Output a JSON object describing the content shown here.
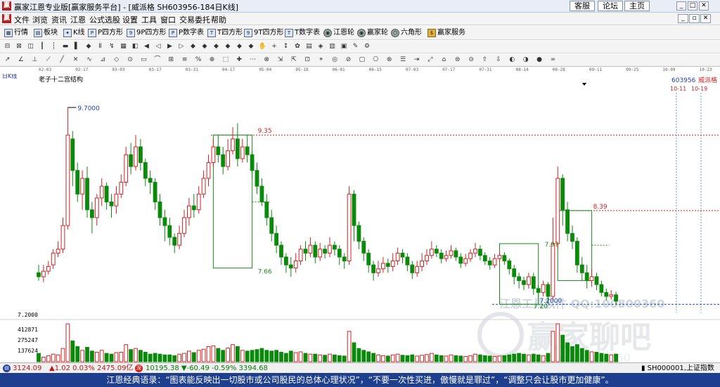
{
  "window": {
    "title": "赢家江恩专业版[赢家服务平台] - [威派格  SH603956-184日K线]",
    "links": [
      "客服",
      "论坛",
      "主页"
    ]
  },
  "menu": [
    "文件",
    "浏览",
    "资讯",
    "江恩",
    "公式选股",
    "设置",
    "工具",
    "窗口",
    "交易委托",
    "帮助"
  ],
  "toolbar": [
    "行情",
    "板块",
    "K线",
    "P四方形",
    "9P四方形",
    "P数字表",
    "T四方形",
    "9T四方形",
    "T数字表",
    "江恩轮",
    "赢家轮",
    "六角形",
    "赢家服务"
  ],
  "date_axis": [
    "02-03",
    "02-17",
    "03-03",
    "03-17",
    "03-31",
    "04-17",
    "05-04",
    "05-18",
    "06-01",
    "06-15",
    "07-03",
    "07-17",
    "07-31",
    "08-14",
    "08-28",
    "09-11",
    "09-25",
    "10-09",
    "10-23"
  ],
  "chart_panel": {
    "period_label": "日K线",
    "structure_label": "老子十二宫结构",
    "stock_code": "603956",
    "stock_name": "威派格",
    "future_dates": [
      "10-11",
      "10-19"
    ],
    "price_labels": {
      "peak": "9.7000",
      "box1_top": "9.35",
      "box1_bottom": "7.66",
      "box2_top": "8.39",
      "ref_line": "7.2000",
      "box3_top": "7.97",
      "box3_bottom": "7.20"
    },
    "ref_axis_label": "7.2000",
    "vol_axis": [
      "412871",
      "275247",
      "137624"
    ],
    "watermark": "江恩工具软件  QQ:100800360",
    "forum_watermark": "赢家聊吧",
    "forum_sub": "liaoba.yingjia360"
  },
  "colors": {
    "up": "#d62020",
    "down": "#0a8a0a",
    "box": "#1a8a1a",
    "resistance": "#d62020",
    "peak_label": "#2040b0"
  },
  "chart_data": {
    "type": "candlestick",
    "title": "威派格 SH603956 日K线",
    "price_range": [
      7.05,
      9.95
    ],
    "reference_prices": [
      9.35,
      8.39,
      7.66,
      7.2
    ],
    "series": [
      {
        "name": "price",
        "values": [
          [
            7.6,
            7.55,
            7.7,
            7.5
          ],
          [
            7.55,
            7.62,
            7.7,
            7.48
          ],
          [
            7.62,
            7.68,
            7.75,
            7.58
          ],
          [
            7.7,
            7.85,
            7.9,
            7.65
          ],
          [
            7.85,
            7.9,
            8.0,
            7.8
          ],
          [
            7.9,
            8.2,
            8.3,
            7.85
          ],
          [
            8.2,
            9.35,
            9.7,
            8.15
          ],
          [
            9.3,
            8.9,
            9.4,
            8.7
          ],
          [
            8.9,
            8.6,
            9.0,
            8.5
          ],
          [
            8.6,
            8.8,
            8.9,
            8.4
          ],
          [
            8.8,
            8.4,
            8.95,
            8.3
          ],
          [
            8.4,
            8.3,
            8.5,
            8.1
          ],
          [
            8.3,
            8.55,
            8.6,
            8.2
          ],
          [
            8.55,
            8.7,
            8.8,
            8.45
          ],
          [
            8.7,
            8.5,
            8.75,
            8.4
          ],
          [
            8.5,
            8.45,
            8.6,
            8.3
          ],
          [
            8.45,
            8.6,
            8.7,
            8.35
          ],
          [
            8.6,
            8.75,
            8.85,
            8.55
          ],
          [
            8.75,
            9.1,
            9.2,
            8.7
          ],
          [
            9.1,
            8.95,
            9.25,
            8.85
          ],
          [
            8.95,
            9.2,
            9.35,
            8.9
          ],
          [
            9.2,
            9.0,
            9.3,
            8.9
          ],
          [
            9.0,
            8.8,
            9.05,
            8.7
          ],
          [
            8.8,
            8.75,
            8.9,
            8.6
          ],
          [
            8.75,
            8.5,
            8.8,
            8.4
          ],
          [
            8.5,
            8.3,
            8.6,
            8.2
          ],
          [
            8.3,
            8.2,
            8.4,
            8.0
          ],
          [
            8.2,
            8.05,
            8.3,
            7.95
          ],
          [
            8.05,
            7.95,
            8.1,
            7.85
          ],
          [
            7.95,
            8.1,
            8.2,
            7.9
          ],
          [
            8.1,
            8.3,
            8.4,
            8.05
          ],
          [
            8.3,
            8.45,
            8.55,
            8.2
          ],
          [
            8.45,
            8.4,
            8.6,
            8.3
          ],
          [
            8.4,
            8.6,
            8.7,
            8.35
          ],
          [
            8.6,
            8.8,
            8.9,
            8.55
          ],
          [
            8.8,
            9.0,
            9.1,
            8.7
          ],
          [
            9.0,
            9.2,
            9.3,
            8.95
          ],
          [
            9.2,
            9.1,
            9.35,
            9.0
          ],
          [
            9.1,
            8.95,
            9.2,
            8.85
          ],
          [
            8.95,
            9.15,
            9.3,
            8.9
          ],
          [
            9.15,
            9.3,
            9.45,
            9.1
          ],
          [
            9.3,
            9.05,
            9.5,
            8.95
          ],
          [
            9.05,
            9.2,
            9.3,
            9.0
          ],
          [
            9.2,
            9.1,
            9.35,
            9.0
          ],
          [
            9.1,
            8.9,
            9.15,
            8.8
          ],
          [
            8.9,
            8.7,
            9.0,
            8.6
          ],
          [
            8.7,
            8.5,
            8.8,
            8.45
          ],
          [
            8.5,
            8.3,
            8.6,
            8.2
          ],
          [
            8.3,
            8.1,
            8.4,
            8.0
          ],
          [
            8.1,
            7.95,
            8.2,
            7.85
          ],
          [
            7.95,
            7.8,
            8.0,
            7.7
          ],
          [
            7.8,
            7.7,
            7.85,
            7.6
          ],
          [
            7.7,
            7.66,
            7.8,
            7.55
          ],
          [
            7.66,
            7.75,
            7.85,
            7.6
          ],
          [
            7.75,
            7.9,
            7.95,
            7.7
          ],
          [
            7.9,
            7.85,
            8.0,
            7.75
          ],
          [
            7.85,
            7.95,
            8.05,
            7.8
          ],
          [
            7.95,
            7.8,
            8.0,
            7.72
          ],
          [
            7.8,
            7.9,
            7.98,
            7.75
          ],
          [
            7.9,
            7.85,
            7.95,
            7.78
          ],
          [
            7.85,
            7.95,
            8.05,
            7.8
          ],
          [
            7.95,
            7.9,
            8.0,
            7.82
          ],
          [
            7.9,
            7.8,
            7.95,
            7.7
          ],
          [
            7.8,
            7.75,
            7.85,
            7.65
          ],
          [
            7.75,
            8.6,
            8.7,
            7.7
          ],
          [
            8.6,
            8.2,
            8.65,
            8.0
          ],
          [
            8.2,
            8.0,
            8.25,
            7.9
          ],
          [
            8.0,
            7.85,
            8.05,
            7.75
          ],
          [
            7.85,
            7.7,
            7.9,
            7.6
          ],
          [
            7.7,
            7.6,
            7.75,
            7.5
          ],
          [
            7.6,
            7.65,
            7.75,
            7.55
          ],
          [
            7.65,
            7.72,
            7.8,
            7.6
          ],
          [
            7.72,
            7.68,
            7.78,
            7.6
          ],
          [
            7.68,
            7.75,
            7.85,
            7.62
          ],
          [
            7.75,
            7.85,
            7.92,
            7.7
          ],
          [
            7.85,
            7.8,
            7.9,
            7.72
          ],
          [
            7.8,
            7.7,
            7.85,
            7.62
          ],
          [
            7.7,
            7.6,
            7.75,
            7.52
          ],
          [
            7.6,
            7.68,
            7.75,
            7.55
          ],
          [
            7.68,
            7.75,
            7.85,
            7.62
          ],
          [
            7.75,
            7.82,
            7.9,
            7.7
          ],
          [
            7.82,
            7.9,
            8.0,
            7.78
          ],
          [
            7.9,
            7.85,
            7.95,
            7.8
          ],
          [
            7.85,
            7.78,
            7.9,
            7.72
          ],
          [
            7.78,
            7.82,
            7.88,
            7.74
          ],
          [
            7.82,
            7.88,
            7.95,
            7.78
          ],
          [
            7.88,
            7.8,
            7.92,
            7.75
          ],
          [
            7.8,
            7.72,
            7.85,
            7.66
          ],
          [
            7.72,
            7.78,
            7.84,
            7.68
          ],
          [
            7.78,
            7.85,
            7.9,
            7.74
          ],
          [
            7.85,
            7.9,
            7.98,
            7.8
          ],
          [
            7.9,
            7.82,
            7.95,
            7.76
          ],
          [
            7.82,
            7.75,
            7.86,
            7.7
          ],
          [
            7.75,
            7.7,
            7.8,
            7.64
          ],
          [
            7.7,
            7.78,
            7.84,
            7.66
          ],
          [
            7.78,
            7.82,
            7.88,
            7.74
          ],
          [
            7.82,
            7.75,
            7.86,
            7.7
          ],
          [
            7.75,
            7.65,
            7.78,
            7.58
          ],
          [
            7.65,
            7.55,
            7.7,
            7.45
          ],
          [
            7.55,
            7.5,
            7.6,
            7.4
          ],
          [
            7.5,
            7.45,
            7.55,
            7.38
          ],
          [
            7.45,
            7.55,
            7.6,
            7.4
          ],
          [
            7.55,
            7.4,
            7.6,
            7.32
          ],
          [
            7.4,
            7.35,
            7.45,
            7.28
          ],
          [
            7.35,
            7.45,
            7.5,
            7.3
          ],
          [
            7.45,
            7.3,
            7.48,
            7.2
          ],
          [
            7.3,
            7.97,
            8.3,
            7.25
          ],
          [
            7.97,
            8.8,
            8.95,
            7.9
          ],
          [
            8.8,
            8.4,
            8.85,
            8.2
          ],
          [
            8.4,
            8.1,
            8.5,
            8.0
          ],
          [
            8.1,
            8.0,
            8.2,
            7.9
          ],
          [
            8.0,
            7.7,
            8.05,
            7.6
          ],
          [
            7.7,
            7.6,
            7.8,
            7.5
          ],
          [
            7.6,
            7.5,
            7.7,
            7.4
          ],
          [
            7.5,
            7.55,
            7.65,
            7.42
          ],
          [
            7.55,
            7.45,
            7.6,
            7.38
          ],
          [
            7.45,
            7.35,
            7.5,
            7.3
          ],
          [
            7.35,
            7.3,
            7.4,
            7.25
          ],
          [
            7.3,
            7.32,
            7.38,
            7.26
          ],
          [
            7.32,
            7.24,
            7.36,
            7.2
          ]
        ]
      },
      {
        "name": "volume",
        "values": [
          0.22,
          0.12,
          0.16,
          0.2,
          0.18,
          0.35,
          1.0,
          0.55,
          0.4,
          0.3,
          0.38,
          0.28,
          0.25,
          0.3,
          0.22,
          0.2,
          0.24,
          0.25,
          0.45,
          0.32,
          0.35,
          0.3,
          0.25,
          0.2,
          0.22,
          0.2,
          0.18,
          0.18,
          0.16,
          0.2,
          0.22,
          0.28,
          0.24,
          0.3,
          0.33,
          0.4,
          0.42,
          0.35,
          0.3,
          0.36,
          0.45,
          0.4,
          0.3,
          0.28,
          0.3,
          0.32,
          0.35,
          0.3,
          0.28,
          0.3,
          0.25,
          0.22,
          0.28,
          0.24,
          0.26,
          0.22,
          0.2,
          0.2,
          0.18,
          0.17,
          0.2,
          0.18,
          0.16,
          0.15,
          0.8,
          0.5,
          0.35,
          0.3,
          0.26,
          0.22,
          0.18,
          0.16,
          0.15,
          0.18,
          0.2,
          0.17,
          0.16,
          0.18,
          0.15,
          0.17,
          0.19,
          0.22,
          0.18,
          0.16,
          0.15,
          0.18,
          0.16,
          0.15,
          0.14,
          0.16,
          0.2,
          0.18,
          0.16,
          0.15,
          0.14,
          0.15,
          0.16,
          0.18,
          0.2,
          0.22,
          0.2,
          0.18,
          0.2,
          0.18,
          0.16,
          0.22,
          0.8,
          1.0,
          0.7,
          0.5,
          0.4,
          0.45,
          0.35,
          0.3,
          0.26,
          0.25,
          0.22,
          0.2,
          0.18,
          0.2
        ]
      }
    ],
    "xlabel": "",
    "ylabel": "",
    "volume_range": [
      0,
      412871
    ]
  }
}
